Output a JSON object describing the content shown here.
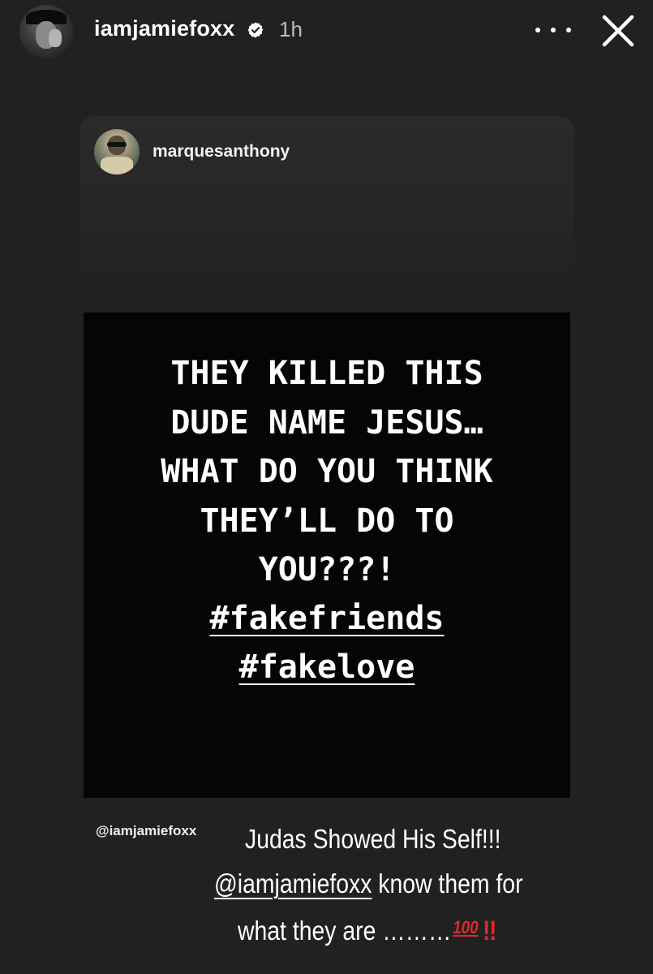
{
  "header": {
    "username": "iamjamiefoxx",
    "time": "1h",
    "more_icon": "more-horizontal-icon",
    "close_icon": "close-icon",
    "verified_icon": "verified-badge-icon"
  },
  "shared_post": {
    "username": "marquesanthony",
    "image_text_lines": [
      "THEY KILLED THIS",
      "DUDE NAME JESUS…",
      "WHAT DO YOU THINK",
      "THEY’LL DO TO",
      "YOU???!"
    ],
    "hashtags": [
      "#fakefriends",
      "#fakelove"
    ]
  },
  "caption": {
    "mention_small": "@iamjamiefoxx",
    "line1": "Judas Showed His Self!!!",
    "line2_mention": "@iamjamiefoxx",
    "line2_rest": " know them for",
    "line3": "what they are ………",
    "emoji_100": "100",
    "emoji_bang": "‼"
  },
  "colors": {
    "background": "#212121",
    "post_background": "#050505",
    "accent_red": "#e0272b",
    "verified_blue": "#ffffff"
  }
}
